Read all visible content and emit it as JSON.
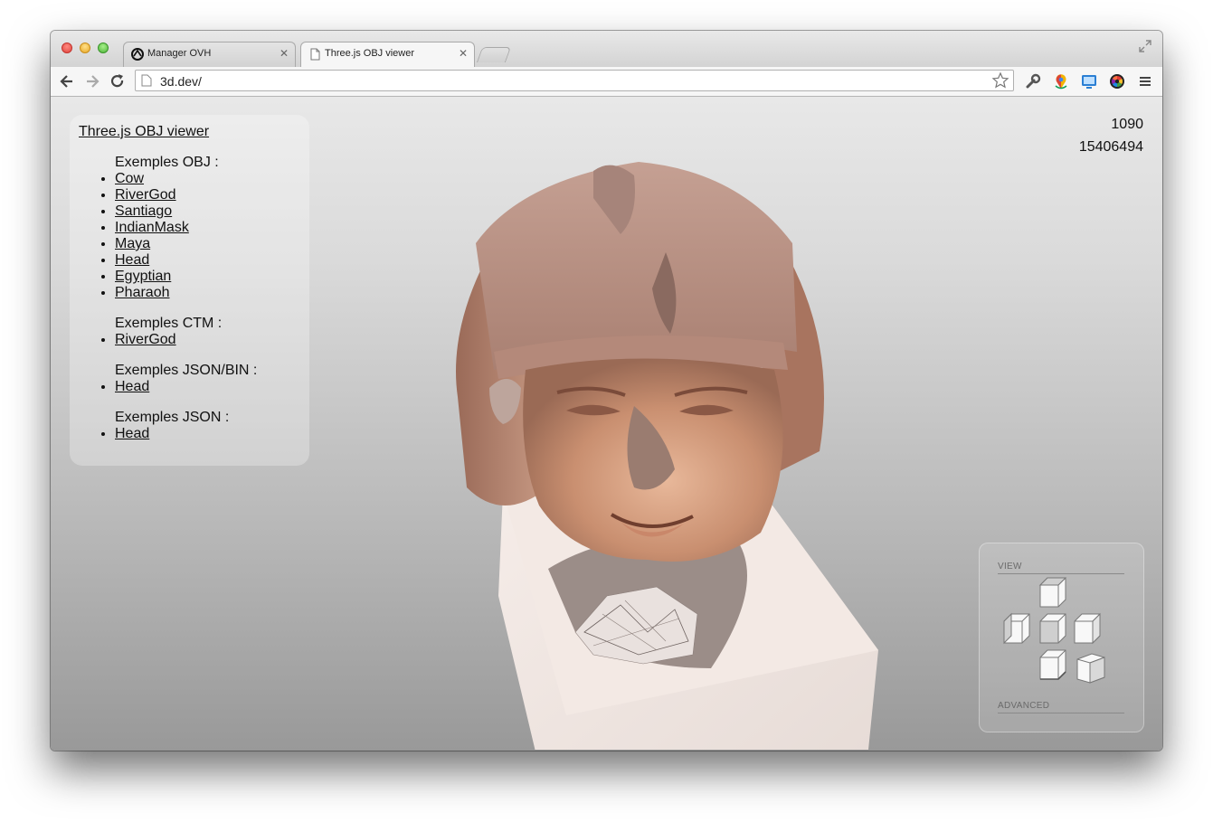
{
  "browser": {
    "tabs": [
      {
        "label": "Manager OVH",
        "active": false,
        "icon": "ovh-logo-icon"
      },
      {
        "label": "Three.js OBJ viewer",
        "active": true,
        "icon": "page-icon"
      }
    ],
    "address": "3d.dev/",
    "toolbar_icons": [
      "back-arrow-icon",
      "forward-arrow-icon",
      "reload-icon",
      "bookmark-star-icon",
      "wrench-icon",
      "location-pin-icon",
      "screen-capture-icon",
      "color-picker-icon",
      "menu-icon"
    ]
  },
  "panel": {
    "title": "Three.js OBJ viewer",
    "groups": [
      {
        "heading": "Exemples OBJ :",
        "items": [
          "Cow",
          "RiverGod",
          "Santiago",
          "IndianMask",
          "Maya",
          "Head",
          "Egyptian",
          "Pharaoh"
        ]
      },
      {
        "heading": "Exemples CTM :",
        "items": [
          "RiverGod"
        ]
      },
      {
        "heading": "Exemples JSON/BIN :",
        "items": [
          "Head"
        ]
      },
      {
        "heading": "Exemples JSON :",
        "items": [
          "Head"
        ]
      }
    ]
  },
  "stats": {
    "line1": "1090",
    "line2": "15406494"
  },
  "view_panel": {
    "view_label": "VIEW",
    "advanced_label": "ADVANCED",
    "cubes": [
      "top",
      "left",
      "front",
      "right",
      "bottom",
      "perspective"
    ]
  },
  "model_subject": "pharaoh-head-3d-model",
  "colors": {
    "content_top": "#e8e8e8",
    "content_bottom": "#999999"
  }
}
